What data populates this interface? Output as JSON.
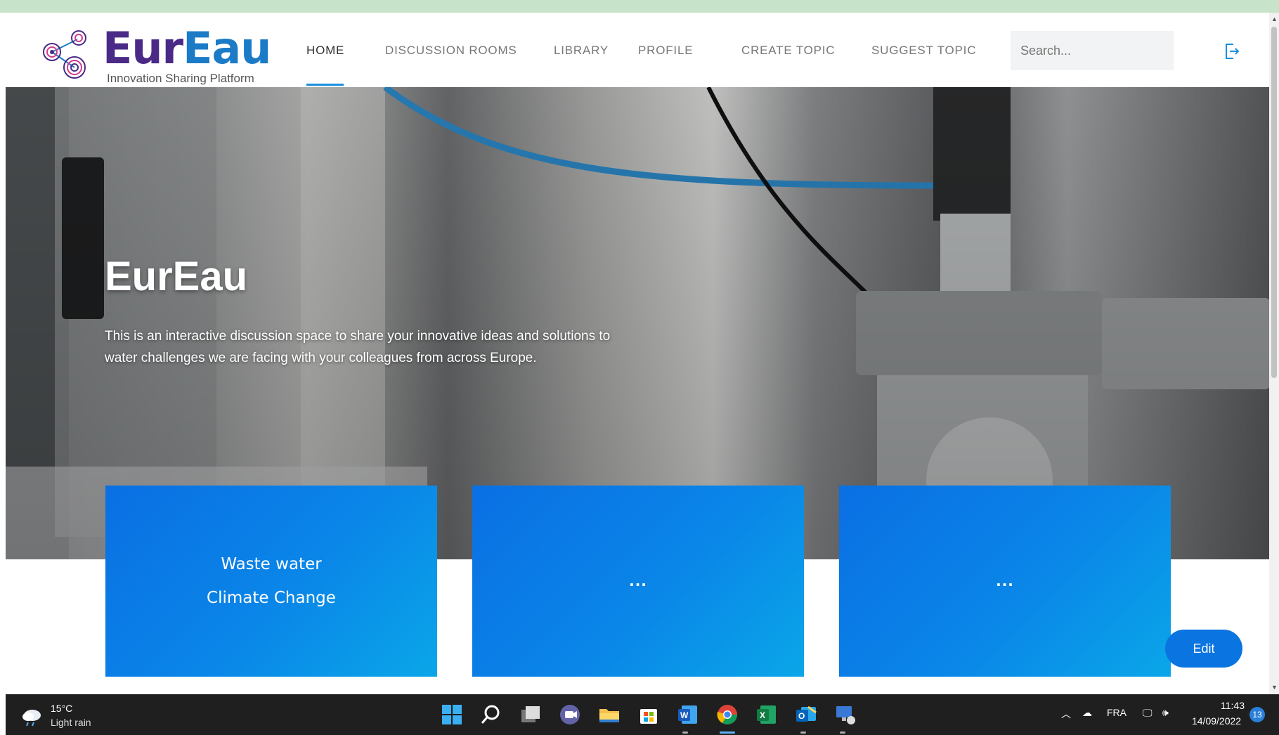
{
  "brand": {
    "name_part1": "Eur",
    "name_part2": "Eau",
    "tagline": "Innovation Sharing Platform",
    "color_primary": "#4a2a86",
    "color_secondary": "#1c7bc7"
  },
  "nav": [
    {
      "label": "HOME",
      "active": true
    },
    {
      "label": "DISCUSSION ROOMS"
    },
    {
      "label": "LIBRARY"
    },
    {
      "label": "PROFILE"
    },
    {
      "label": "CREATE TOPIC"
    },
    {
      "label": "SUGGEST TOPIC"
    }
  ],
  "search": {
    "placeholder": "Search..."
  },
  "hero": {
    "title": "EurEau",
    "text": "This is an interactive discussion space to share your innovative ideas and solutions to water challenges we are facing with your colleagues from across Europe."
  },
  "cards": [
    {
      "lines": [
        "Waste water",
        "Climate Change"
      ]
    },
    {
      "lines": [
        "..."
      ]
    },
    {
      "lines": [
        "..."
      ]
    }
  ],
  "edit_button": {
    "label": "Edit"
  },
  "taskbar": {
    "weather": {
      "temperature": "15°C",
      "description": "Light rain"
    },
    "apps": [
      "start-icon",
      "search-icon",
      "task-view-icon",
      "teams-icon",
      "file-explorer-icon",
      "store-icon",
      "word-icon",
      "chrome-icon",
      "excel-icon",
      "outlook-icon",
      "remote-desktop-icon"
    ],
    "language": "FRA",
    "time": "11:43",
    "date": "14/09/2022",
    "notifications": "13"
  },
  "colors": {
    "accent": "#1b8fe0",
    "card_blue": "#0a86e8",
    "top_strip": "#c7e3c9"
  }
}
